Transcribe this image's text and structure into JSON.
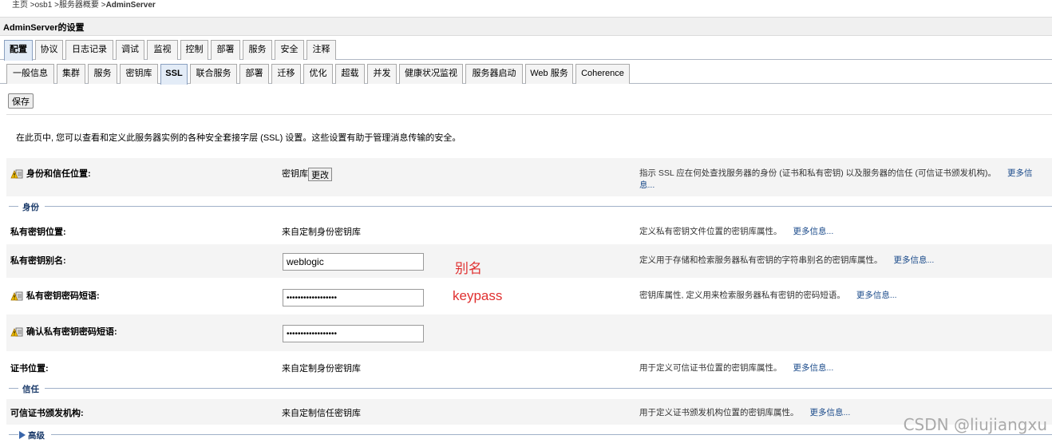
{
  "breadcrumb": [
    {
      "label": "主页"
    },
    {
      "label": "osb1"
    },
    {
      "label": "服务器概要"
    },
    {
      "label": "AdminServer"
    }
  ],
  "breadcrumb_sep": ">",
  "page_title": "AdminServer的设置",
  "tabs_main": [
    "配置",
    "协议",
    "日志记录",
    "调试",
    "监视",
    "控制",
    "部署",
    "服务",
    "安全",
    "注释"
  ],
  "tabs_sub": [
    "一般信息",
    "集群",
    "服务",
    "密钥库",
    "SSL",
    "联合服务",
    "部署",
    "迁移",
    "优化",
    "超载",
    "并发",
    "健康状况监视",
    "服务器启动",
    "Web 服务",
    "Coherence"
  ],
  "save_label": "保存",
  "intro": "在此页中, 您可以查看和定义此服务器实例的各种安全套接字层 (SSL) 设置。这些设置有助于管理消息传输的安全。",
  "more_info": "更多信息...",
  "identity_trust": {
    "label": "身份和信任位置:",
    "value": "密钥库",
    "change_label": "更改",
    "desc_1": "指示 SSL 应在何处查找服务器的身份 (证书和私有密钥) 以及服务器的信任 (可信证书颁发机构)。",
    "more_1": "更多信",
    "more_2": "息..."
  },
  "section_identity": "身份",
  "private_key_location": {
    "label": "私有密钥位置:",
    "value": "来自定制身份密钥库",
    "desc": "定义私有密钥文件位置的密钥库属性。"
  },
  "private_key_alias": {
    "label": "私有密钥别名:",
    "value": "weblogic",
    "desc": "定义用于存储和检索服务器私有密钥的字符串别名的密钥库属性。"
  },
  "private_key_pass": {
    "label": "私有密钥密码短语:",
    "value": "••••••••••••••••••",
    "desc": "密钥库属性, 定义用来检索服务器私有密钥的密码短语。"
  },
  "confirm_pass": {
    "label": "确认私有密钥密码短语:",
    "value": "••••••••••••••••••"
  },
  "cert_location": {
    "label": "证书位置:",
    "value": "来自定制身份密钥库",
    "desc": "用于定义可信证书位置的密钥库属性。"
  },
  "section_trust": "信任",
  "trusted_ca": {
    "label": "可信证书颁发机构:",
    "value": "来自定制信任密钥库",
    "desc": "用于定义证书颁发机构位置的密钥库属性。"
  },
  "section_advanced": "高级",
  "annotations": {
    "alias": "别名",
    "keypass": "keypass"
  },
  "watermark": "CSDN @liujiangxu",
  "colors": {
    "annotation": "#e03030",
    "link": "#1a4a8a",
    "active_tab": "#e3ecf7",
    "row_shade": "#f4f4f4"
  }
}
